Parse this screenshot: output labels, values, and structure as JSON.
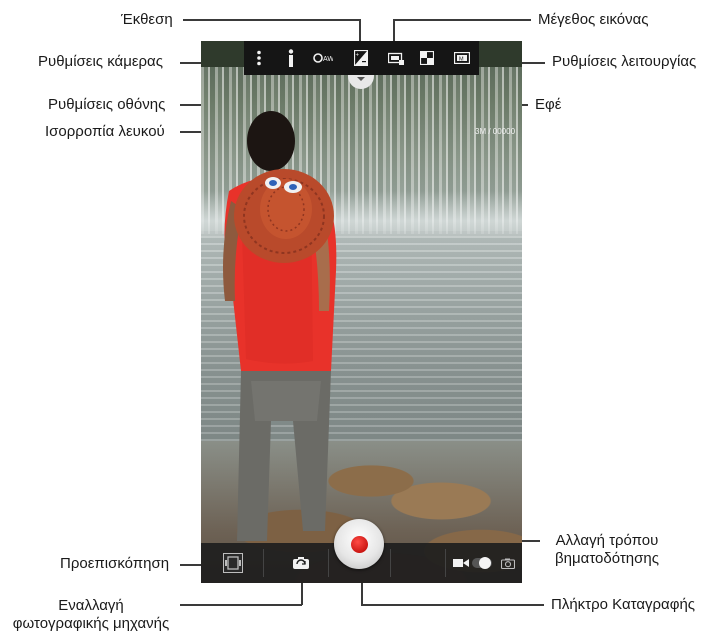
{
  "callouts": {
    "exposure": "Έκθεση",
    "image_size": "Μέγεθος εικόνας",
    "camera_settings": "Ρυθμίσεις κάμερας",
    "mode_settings": "Ρυθμίσεις λειτουργίας",
    "screen_settings": "Ρυθμίσεις οθόνης",
    "effect": "Εφέ",
    "white_balance": "Ισορροπία λευκού",
    "switch_mode_line1": "Αλλαγή τρόπου",
    "switch_mode_line2": "βηματοδότησης",
    "preview": "Προεπισκόπηση",
    "switch_camera_line1": "Εναλλαγή",
    "switch_camera_line2": "φωτογραφικής μηχανής",
    "record_button": "Πλήκτρο Καταγραφής"
  },
  "viewfinder": {
    "resolution_counter": "3M / 00000"
  },
  "toolbar": {
    "icons": [
      "more-vert-icon",
      "info-icon",
      "white-balance-auto-icon",
      "exposure-icon",
      "image-size-icon",
      "effect-icon",
      "scene-mode-icon"
    ],
    "white_balance_glyph": "AW"
  },
  "bottom": {
    "icons": [
      "preview-thumbnail-icon",
      "switch-camera-icon",
      "shutter-record-icon",
      "video-mode-icon",
      "photo-mode-icon"
    ]
  },
  "colors": {
    "shutter_red": "#c4100c",
    "toolbar_bg": "#151515"
  }
}
